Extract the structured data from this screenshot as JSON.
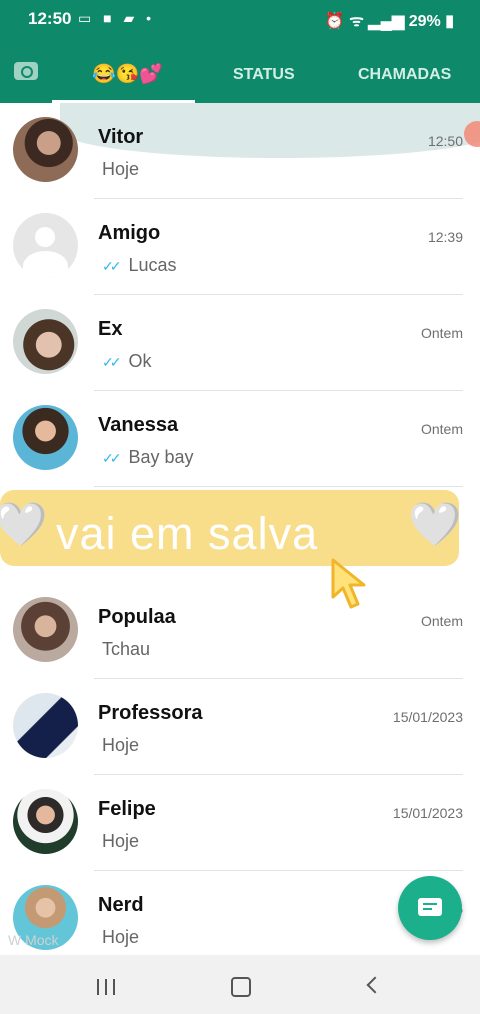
{
  "status_bar": {
    "time": "12:50",
    "left_icons": [
      "message-icon",
      "video-icon",
      "folder-icon",
      "dot-icon"
    ],
    "right_icons": [
      "alarm-icon",
      "wifi-icon",
      "4g-icon",
      "signal-icon",
      "battery-icon"
    ],
    "battery": "29%"
  },
  "tabs": {
    "chats_label": "😂😘💕",
    "status_label": "STATUS",
    "calls_label": "CHAMADAS"
  },
  "chats": [
    {
      "name": "Vitor",
      "preview": "Hoje",
      "time": "12:50",
      "read": false
    },
    {
      "name": "Amigo",
      "preview": "Lucas",
      "time": "12:39",
      "read": true
    },
    {
      "name": "Ex",
      "preview": "Ok",
      "time": "Ontem",
      "read": true
    },
    {
      "name": "Vanessa",
      "preview": "Bay bay",
      "time": "Ontem",
      "read": true
    },
    {
      "name": "Populaa",
      "preview": "Tchau",
      "time": "Ontem",
      "read": false
    },
    {
      "name": "Professora",
      "preview": "Hoje",
      "time": "15/01/2023",
      "read": false
    },
    {
      "name": "Felipe",
      "preview": "Hoje",
      "time": "15/01/2023",
      "read": false
    },
    {
      "name": "Nerd",
      "preview": "Hoje",
      "time": "15",
      "read": false
    }
  ],
  "overlay": {
    "text": "vai em salva",
    "left_heart": "🤍",
    "right_heart": "🤍"
  },
  "watermark": "W Mock",
  "read_ticks": "✓✓",
  "colors": {
    "header": "#0e8a6a",
    "fab": "#1bb08b",
    "ticks": "#34b7f1",
    "overlay": "#f7d87a"
  }
}
